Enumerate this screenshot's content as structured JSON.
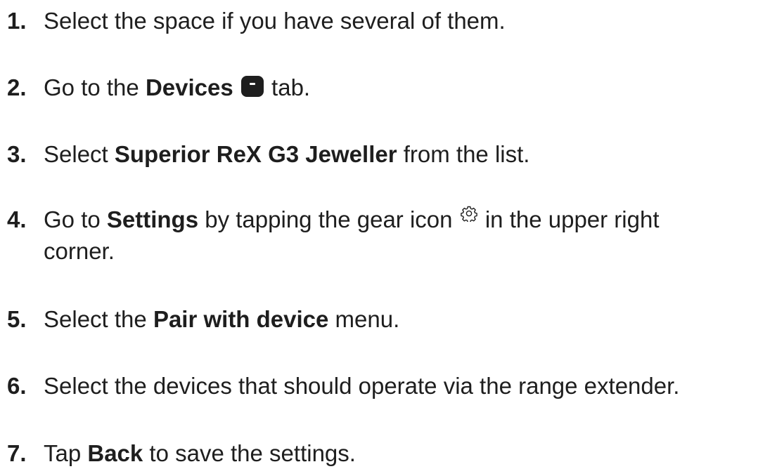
{
  "steps": [
    {
      "num": "1.",
      "text": "Select the space if you have several of them."
    },
    {
      "num": "2.",
      "pre": "Go to the ",
      "bold": "Devices",
      "icon": "devices-icon",
      "post": " tab."
    },
    {
      "num": "3.",
      "pre": "Select ",
      "bold": "Superior ReX G3 Jeweller",
      "post": " from the list."
    },
    {
      "num": "4.",
      "pre": "Go to ",
      "bold": "Settings",
      "mid": " by tapping the gear icon ",
      "icon": "gear-icon",
      "post": " in the upper right",
      "cont": "corner."
    },
    {
      "num": "5.",
      "pre": "Select the ",
      "bold": "Pair with device",
      "post": " menu."
    },
    {
      "num": "6.",
      "text": "Select the devices that should operate via the range extender."
    },
    {
      "num": "7.",
      "pre": "Tap ",
      "bold": "Back",
      "post": " to save the settings."
    }
  ]
}
